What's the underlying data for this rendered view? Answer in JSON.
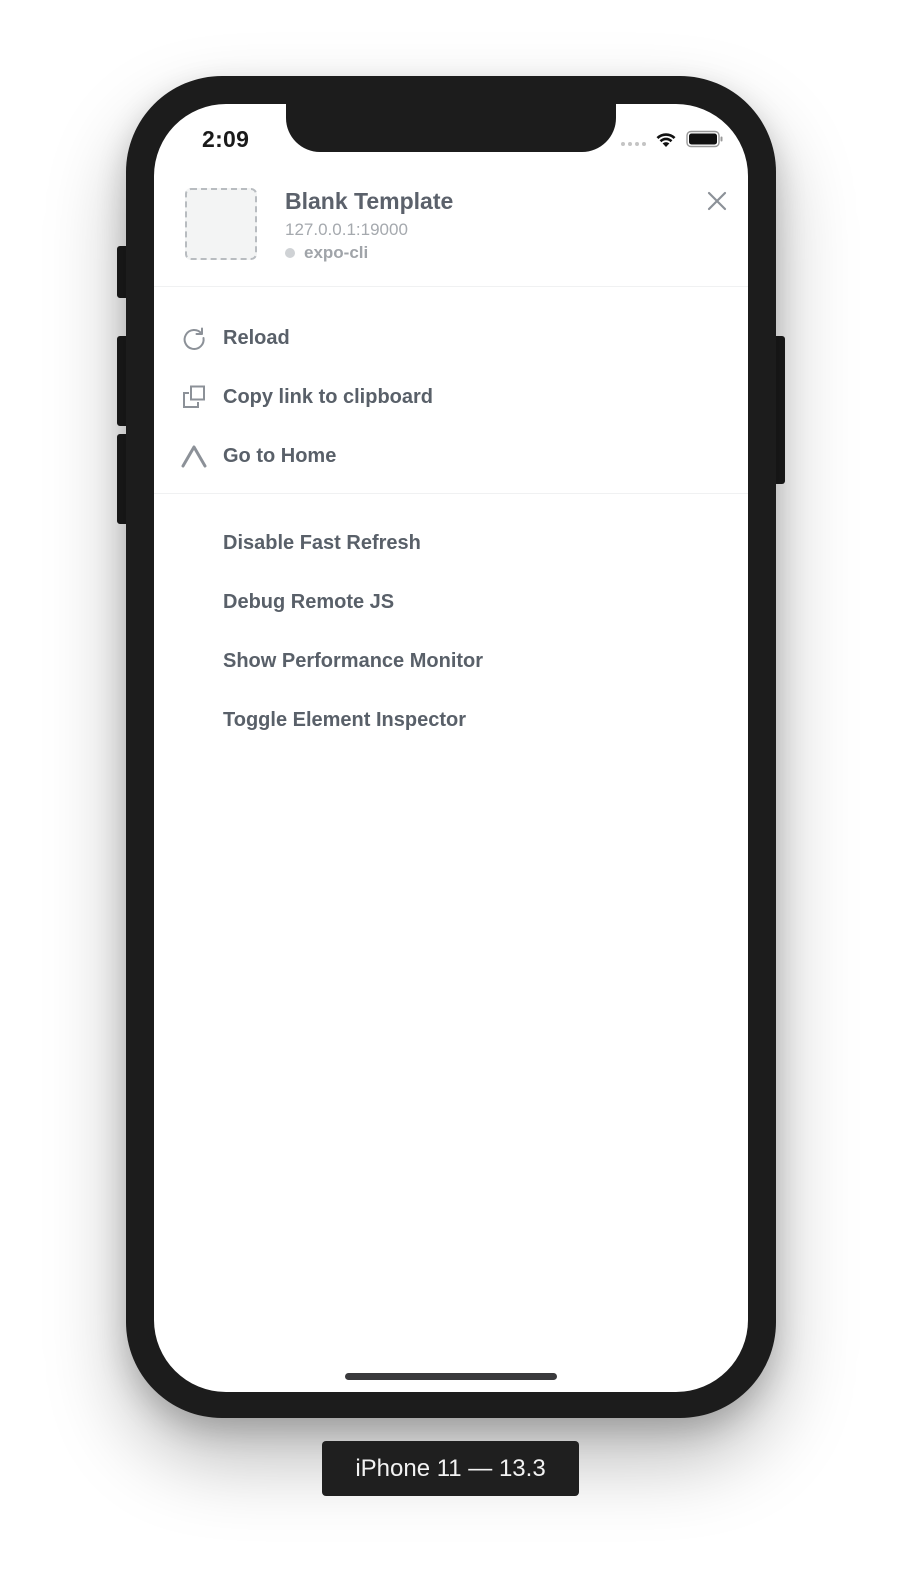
{
  "status_bar": {
    "time": "2:09"
  },
  "header": {
    "app_title": "Blank Template",
    "app_url": "127.0.0.1:19000",
    "app_source": "expo-cli"
  },
  "menu": {
    "primary": [
      {
        "label": "Reload",
        "icon": "reload-icon"
      },
      {
        "label": "Copy link to clipboard",
        "icon": "copy-icon"
      },
      {
        "label": "Go to Home",
        "icon": "home-chevron-icon"
      }
    ],
    "developer": [
      {
        "label": "Disable Fast Refresh"
      },
      {
        "label": "Debug Remote JS"
      },
      {
        "label": "Show Performance Monitor"
      },
      {
        "label": "Toggle Element Inspector"
      }
    ]
  },
  "device": {
    "label": "iPhone 11 — 13.3"
  },
  "colors": {
    "text_primary": "#596069",
    "text_muted": "#a5a9ae",
    "frame": "#1c1c1c"
  }
}
